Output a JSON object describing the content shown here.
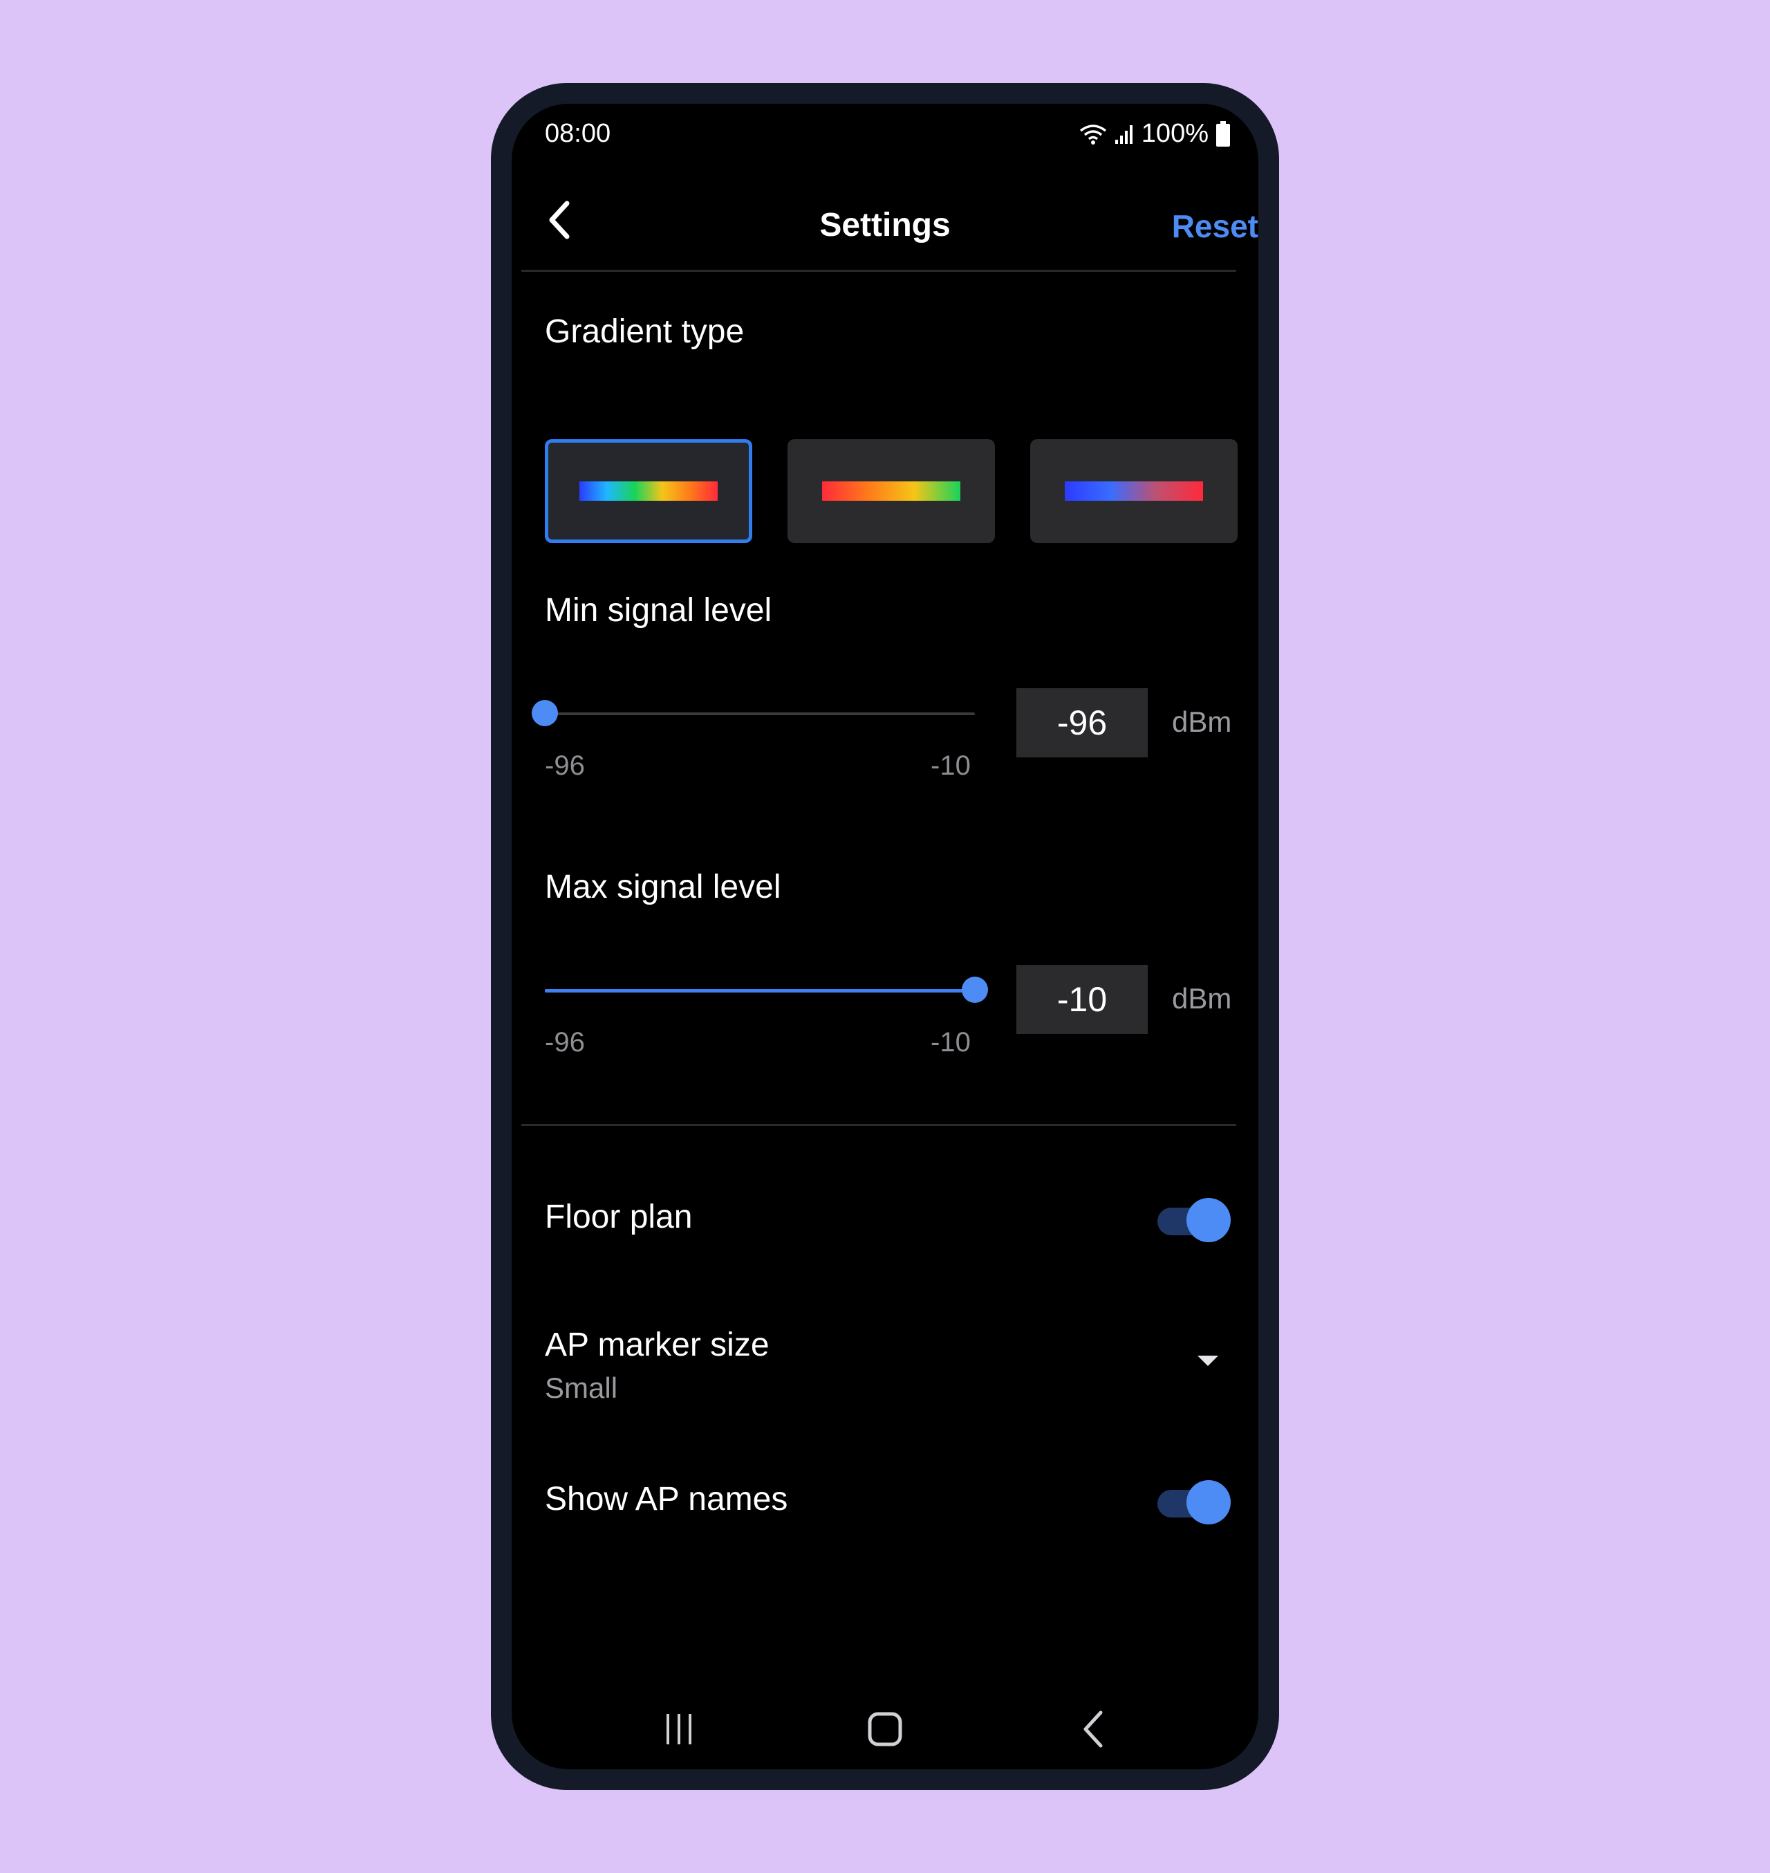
{
  "status_bar": {
    "time": "08:00",
    "battery": "100%"
  },
  "header": {
    "title": "Settings",
    "reset_label": "Reset"
  },
  "gradient": {
    "label": "Gradient type",
    "options": [
      {
        "name": "spectrum",
        "selected": true,
        "colors": [
          "#2a3cff",
          "#1fb8ff",
          "#18d35a",
          "#f5c518",
          "#ff7a1a",
          "#ff2a3a"
        ]
      },
      {
        "name": "warm-to-green",
        "selected": false,
        "colors": [
          "#ff2a3a",
          "#ff7a1a",
          "#f5c518",
          "#18d35a"
        ]
      },
      {
        "name": "blue-to-red",
        "selected": false,
        "colors": [
          "#2a3cff",
          "#3a6cff",
          "#c05070",
          "#ff2a3a"
        ]
      }
    ]
  },
  "min_signal": {
    "label": "Min signal level",
    "value": "-96",
    "unit": "dBm",
    "range_min": "-96",
    "range_max": "-10",
    "fraction": 0
  },
  "max_signal": {
    "label": "Max signal level",
    "value": "-10",
    "unit": "dBm",
    "range_min": "-96",
    "range_max": "-10",
    "fraction": 1
  },
  "floor_plan": {
    "label": "Floor plan",
    "enabled": true
  },
  "ap_marker": {
    "label": "AP marker size",
    "value": "Small"
  },
  "show_ap_names": {
    "label": "Show AP names",
    "enabled": true
  },
  "colors": {
    "accent": "#4d8cf5",
    "background": "#000000",
    "card": "#2b2b2d",
    "page": "#dcc4f9"
  }
}
